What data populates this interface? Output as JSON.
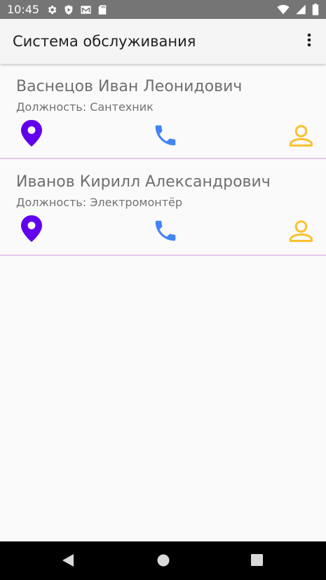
{
  "status_bar": {
    "time": "10:45",
    "left_icons": [
      "settings-icon",
      "play-protect-icon",
      "gmail-icon",
      "sd-card-icon"
    ],
    "right_icons": [
      "wifi-icon",
      "signal-icon",
      "battery-icon"
    ]
  },
  "app_bar": {
    "title": "Система обслуживания",
    "overflow_icon": "more-vert-icon"
  },
  "employees": [
    {
      "name": "Васнецов Иван Леонидович",
      "position": "Должность: Сантехник"
    },
    {
      "name": "Иванов Кирилл Александрович",
      "position": "Должность: Электромонтёр"
    }
  ],
  "actions": {
    "location_icon": "location-pin-icon",
    "phone_icon": "phone-icon",
    "person_icon": "person-icon"
  },
  "colors": {
    "location": "#6200ee",
    "phone": "#4285f4",
    "person": "#fbc02d",
    "divider": "#e5c9ec",
    "status_bar": "#757575",
    "app_bar": "#f5f5f5"
  },
  "nav_bar": {
    "buttons": [
      "back-icon",
      "home-icon",
      "recents-icon"
    ]
  }
}
